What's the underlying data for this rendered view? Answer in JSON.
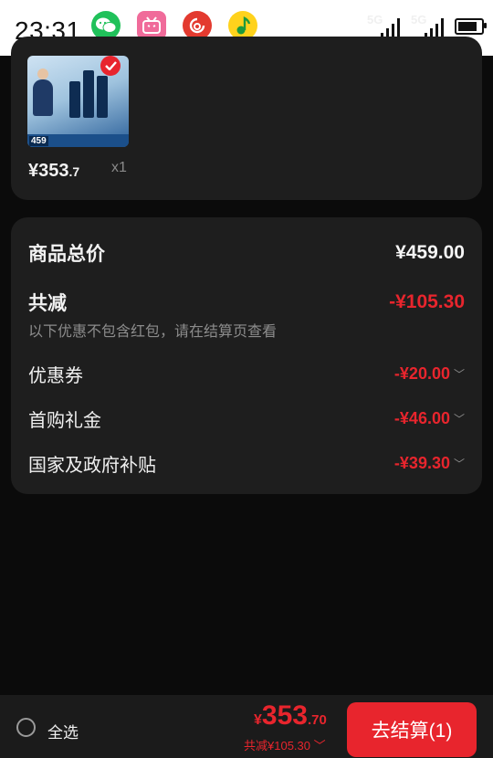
{
  "status_bar": {
    "time": "23:31",
    "apps": [
      "wechat-icon",
      "bilibili-icon",
      "netease-music-icon",
      "qq-music-icon"
    ],
    "signal1": "5G",
    "signal2": "5G"
  },
  "item": {
    "thumb_price": "459",
    "price_int": "¥353",
    "price_dec": ".7",
    "qty": "x1",
    "selected": true
  },
  "summary": {
    "total_label": "商品总价",
    "total_value": "¥459.00",
    "discount_label": "共减",
    "discount_value": "-¥105.30",
    "note": "以下优惠不包含红包，请在结算页查看",
    "lines": [
      {
        "label": "优惠券",
        "value": "-¥20.00"
      },
      {
        "label": "首购礼金",
        "value": "-¥46.00"
      },
      {
        "label": "国家及政府补贴",
        "value": "-¥39.30"
      }
    ]
  },
  "bottom": {
    "select_all": "全选",
    "currency": "¥",
    "total_int": "353",
    "total_dec": ".70",
    "discount": "共减¥105.30",
    "checkout": "去结算(1)"
  },
  "colors": {
    "accent": "#e8252d",
    "background": "#0b0b0b",
    "card": "#1e1e1e"
  }
}
